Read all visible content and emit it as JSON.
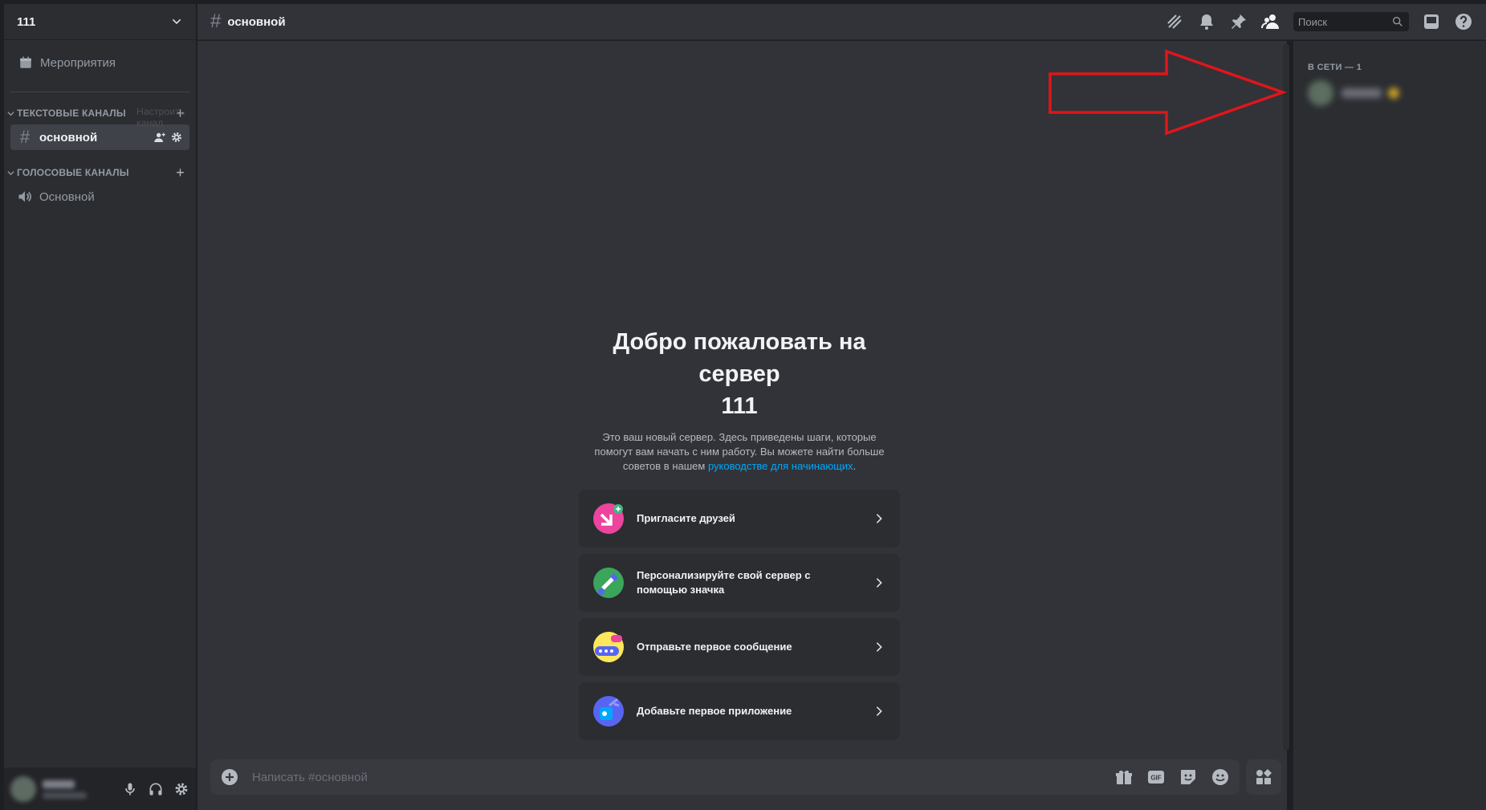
{
  "server": {
    "name": "111"
  },
  "sidebar": {
    "events_label": "Мероприятия",
    "text_category": "ТЕКСТОВЫЕ КАНАЛЫ",
    "text_category_tooltip": "Настроить канал",
    "text_channels": [
      {
        "label": "основной"
      }
    ],
    "voice_category": "ГОЛОСОВЫЕ КАНАЛЫ",
    "voice_channels": [
      {
        "label": "Основной"
      }
    ]
  },
  "topbar": {
    "channel_title": "основной",
    "search_placeholder": "Поиск"
  },
  "welcome": {
    "title_line1": "Добро пожаловать на",
    "title_line2": "сервер",
    "title_line3": "111",
    "desc": "Это ваш новый сервер. Здесь приведены шаги, которые помогут вам начать с ним работу. Вы можете найти больше советов в нашем ",
    "link": "руководстве для начинающих",
    "desc_end": "."
  },
  "cards": [
    {
      "label": "Пригласите друзей",
      "icon": "invite-icon",
      "color": "#eb459e"
    },
    {
      "label": "Персонализируйте свой сервер с помощью значка",
      "icon": "brush-icon",
      "color": "#3ba55c"
    },
    {
      "label": "Отправьте первое сообщение",
      "icon": "message-icon",
      "color": "#fee75c"
    },
    {
      "label": "Добавьте первое приложение",
      "icon": "app-icon",
      "color": "#5865f2"
    }
  ],
  "composer": {
    "placeholder": "Написать #основной"
  },
  "members": {
    "online_header": "В СЕТИ — 1"
  },
  "colors": {
    "accent": "#00a8fc",
    "annotation_arrow": "#e0151b"
  }
}
